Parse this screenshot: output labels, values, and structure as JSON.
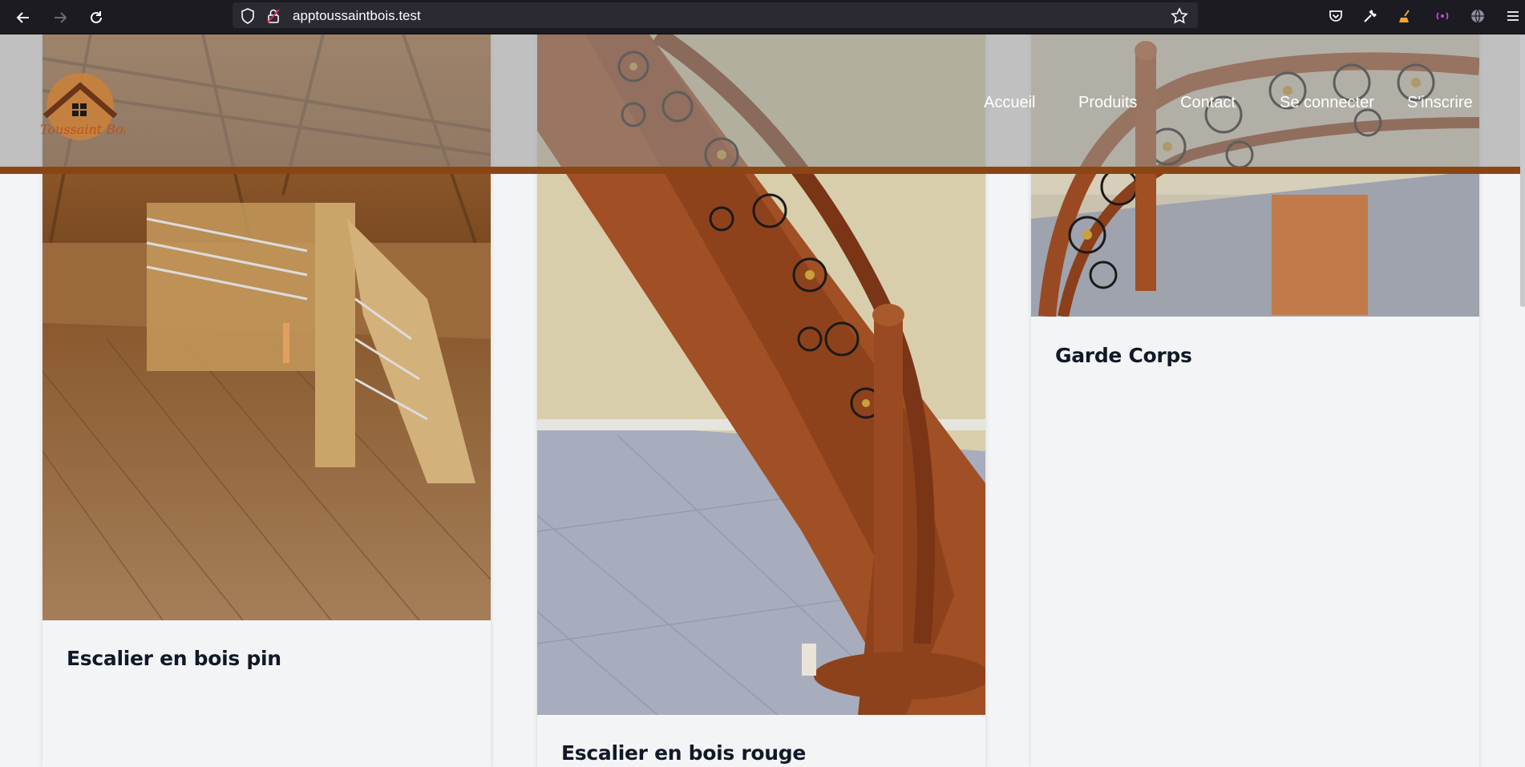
{
  "browser": {
    "url": "apptoussaintbois.test"
  },
  "site": {
    "logo_text": "Toussaint Bois",
    "nav": [
      {
        "label": "Accueil"
      },
      {
        "label": "Produits"
      },
      {
        "label": "Contact"
      },
      {
        "label": "Se connecter"
      },
      {
        "label": "S'inscrire"
      }
    ]
  },
  "products": [
    {
      "title": "Escalier en bois pin"
    },
    {
      "title": "Escalier en bois rouge"
    },
    {
      "title": "Garde Corps"
    }
  ],
  "colors": {
    "accent": "#8b4513",
    "header_overlay": "#969696",
    "title_text": "#111827"
  }
}
